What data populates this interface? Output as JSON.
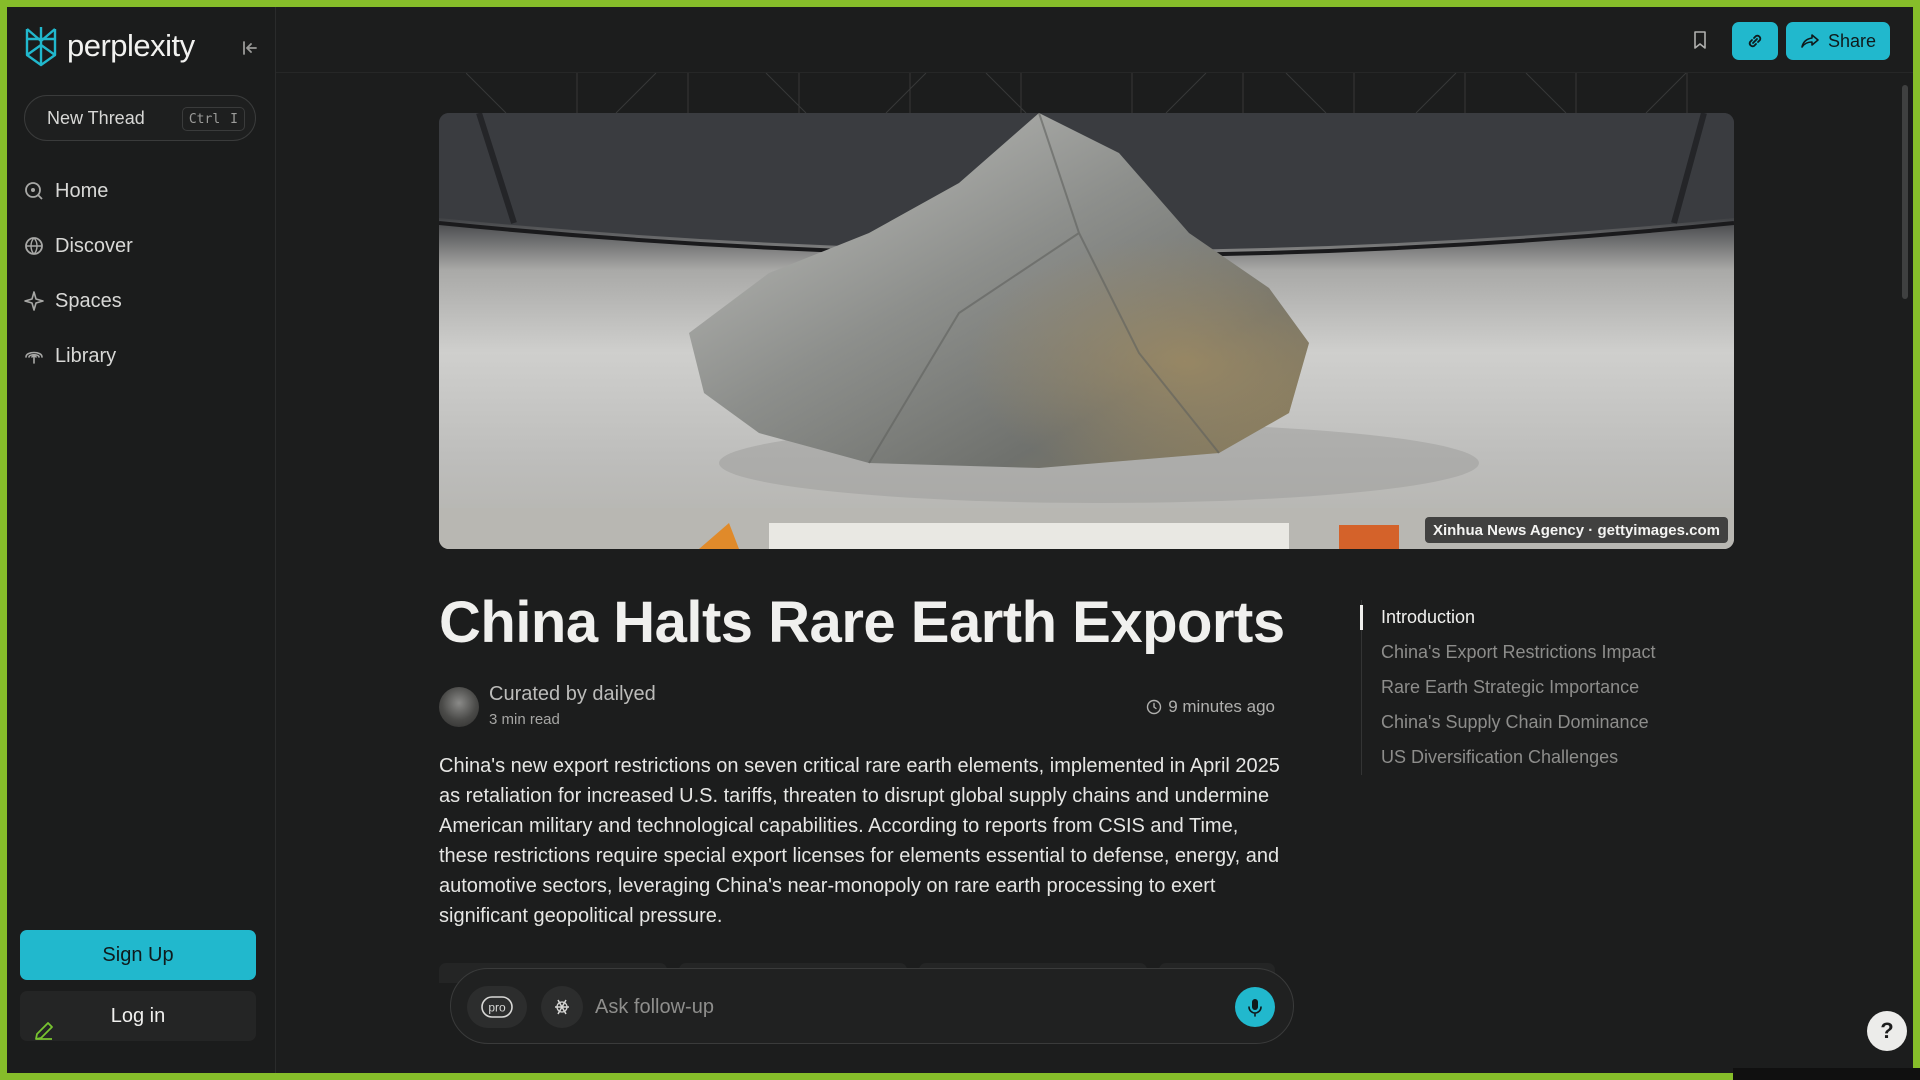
{
  "app": {
    "name": "perplexity"
  },
  "sidebar": {
    "new_thread_label": "New Thread",
    "shortcut_keys": [
      "Ctrl",
      "I"
    ],
    "nav_items": [
      {
        "label": "Home",
        "icon": "home-icon"
      },
      {
        "label": "Discover",
        "icon": "globe-icon"
      },
      {
        "label": "Spaces",
        "icon": "sparkle-icon"
      },
      {
        "label": "Library",
        "icon": "library-icon"
      }
    ],
    "signup_label": "Sign Up",
    "login_label": "Log in"
  },
  "topbar": {
    "share_label": "Share"
  },
  "hero": {
    "credit": "Xinhua News Agency · gettyimages.com"
  },
  "article": {
    "title": "China Halts Rare Earth Exports",
    "curated_by": "Curated by dailyed",
    "read_time": "3 min read",
    "time_ago": "9 minutes ago",
    "summary": "China's new export restrictions on seven critical rare earth elements, implemented in April 2025 as retaliation for increased U.S. tariffs, threaten to disrupt global supply chains and undermine American military and technological capabilities. According to reports from CSIS and Time, these restrictions require special export licenses for elements essential to defense, energy, and automotive sectors, leveraging China's near-monopoly on rare earth processing to exert significant geopolitical pressure."
  },
  "toc": {
    "items": [
      "Introduction",
      "China's Export Restrictions Impact",
      "Rare Earth Strategic Importance",
      "China's Supply Chain Dominance",
      "US Diversification Challenges"
    ],
    "active_index": 0
  },
  "followup": {
    "placeholder": "Ask follow-up",
    "pro_label": "pro"
  },
  "help_label": "?",
  "colors": {
    "accent": "#21b8cd",
    "background": "#1c1d1d",
    "frame": "#86bd2a"
  }
}
